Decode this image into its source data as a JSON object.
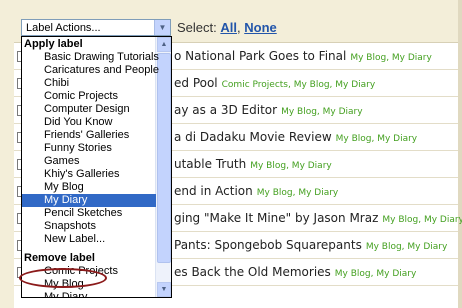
{
  "toolbar": {
    "select_value": "Label Actions...",
    "select_text": "Select:",
    "select_all": "All",
    "select_none": "None"
  },
  "dropdown": {
    "apply_group": "Apply label",
    "apply_items": [
      "Basic Drawing Tutorials",
      "Caricatures and People",
      "Chibi",
      "Comic Projects",
      "Computer Design",
      "Did You Know",
      "Friends' Galleries",
      "Funny Stories",
      "Games",
      "Khiy's Galleries",
      "My Blog",
      "My Diary",
      "Pencil Sketches",
      "Snapshots",
      "New Label..."
    ],
    "selected_item": "My Diary",
    "remove_group": "Remove label",
    "remove_items": [
      "Comic Projects",
      "My Blog",
      "My Diary"
    ]
  },
  "messages": [
    {
      "subject": "o National Park Goes to Final",
      "labels": "My Blog, My Diary"
    },
    {
      "subject": "ed Pool",
      "labels": "Comic Projects, My Blog, My Diary"
    },
    {
      "subject": "ay as a 3D Editor",
      "labels": "My Blog, My Diary"
    },
    {
      "subject": "a di Dadaku Movie Review",
      "labels": "My Blog, My Diary"
    },
    {
      "subject": "utable Truth",
      "labels": "My Blog, My Diary"
    },
    {
      "subject": "end in Action",
      "labels": "My Blog, My Diary"
    },
    {
      "subject": "ging \"Make It Mine\" by Jason Mraz",
      "labels": "My Blog, My Diary"
    },
    {
      "subject": " Pants: Spongebob Squarepants",
      "labels": "My Blog, My Diary"
    },
    {
      "subject": "es Back the Old Memories",
      "labels": "My Blog, My Diary"
    }
  ],
  "colors": {
    "selected_highlight": "#3169c6",
    "label_green": "#44a020",
    "annotation_circle": "#8b1a1a"
  }
}
